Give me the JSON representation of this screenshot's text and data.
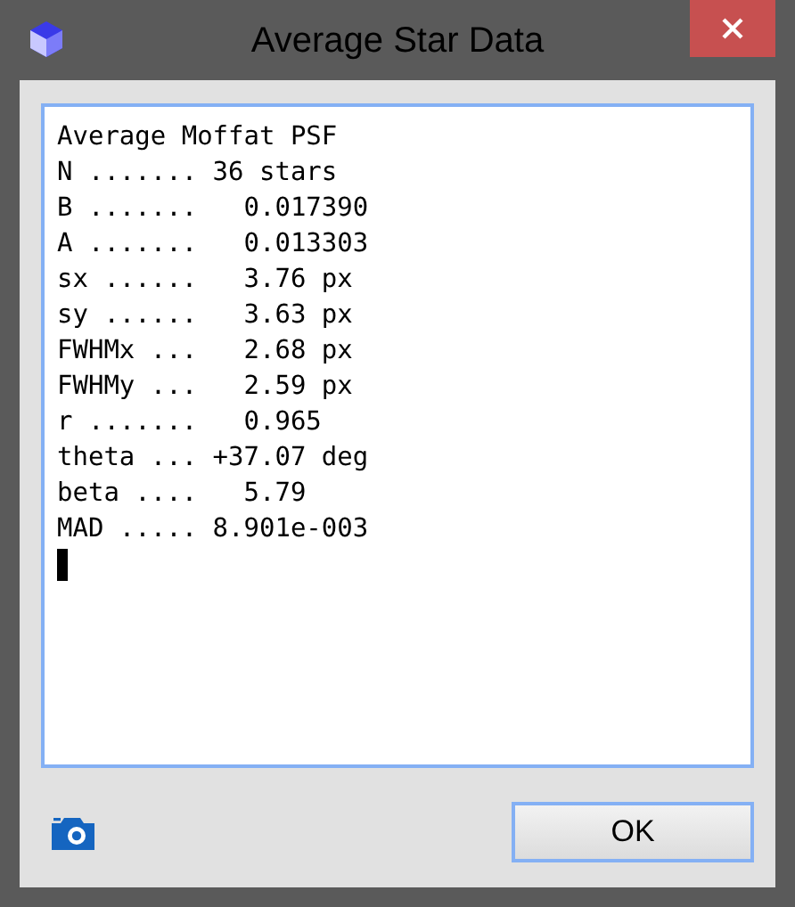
{
  "window": {
    "title": "Average Star Data"
  },
  "output_lines": [
    "Average Moffat PSF",
    "N ....... 36 stars",
    "B .......   0.017390",
    "A .......   0.013303",
    "sx ......   3.76 px",
    "sy ......   3.63 px",
    "FWHMx ...   2.68 px",
    "FWHMy ...   2.59 px",
    "r .......   0.965",
    "theta ... +37.07 deg",
    "beta ....   5.79",
    "MAD ..... 8.901e-003"
  ],
  "buttons": [
    {
      "label": "OK"
    }
  ]
}
